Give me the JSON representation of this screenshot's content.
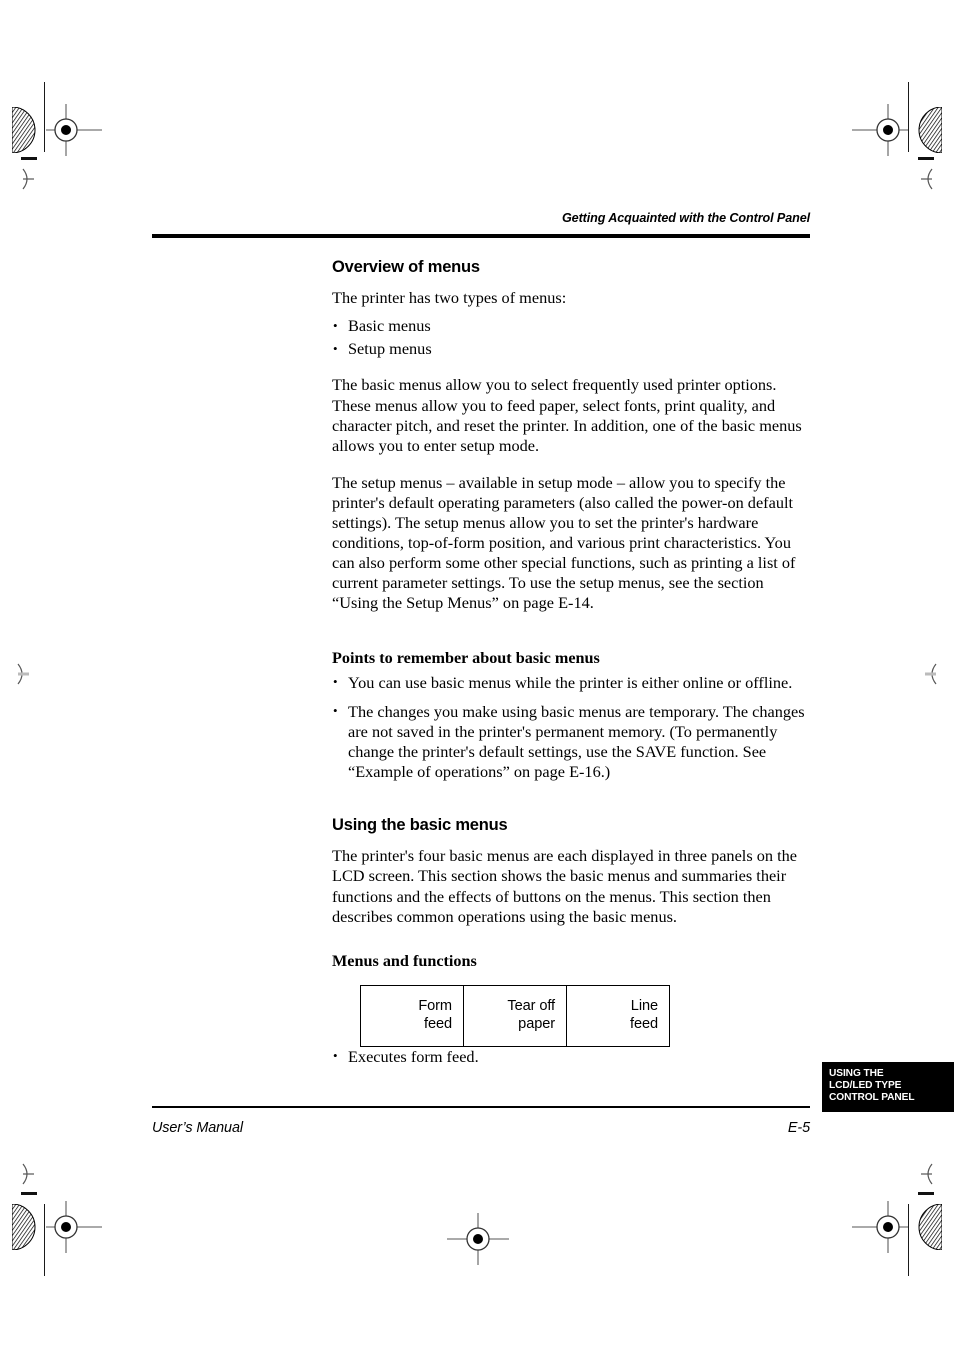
{
  "header": {
    "running_head": "Getting Acquainted with the Control Panel"
  },
  "content": {
    "section_title": "Overview of menus",
    "intro_paragraph": "The printer has two types of menus:",
    "menu_types": [
      "Basic menus",
      "Setup menus"
    ],
    "basic_menus_paragraph": "The basic menus allow you to select frequently used printer options. These menus allow you to feed paper, select fonts, print quality, and character pitch, and reset the printer. In addition, one of the basic menus allows you to enter setup mode.",
    "setup_menus_paragraph": "The setup menus – available in setup mode – allow you to specify the printer's default operating parameters (also called the power-on default settings). The setup menus allow you to set the printer's hardware conditions, top-of-form position, and various print characteristics. You can also perform some other special functions, such as printing a list of current parameter settings. To use the setup menus, see the section “Using the Setup Menus” on page E-14.",
    "points_heading": "Points to remember about basic menus",
    "points": [
      "You can use basic menus while the printer is either online or offline.",
      "The changes you make using basic menus are temporary. The changes are not saved in the printer's permanent memory. (To permanently change the printer's default settings, use the SAVE function. See “Example of operations” on page E-16.)"
    ],
    "using_heading": "Using the basic menus",
    "using_paragraph": "The printer's four basic menus are each displayed in three panels on the LCD screen. This section shows the basic menus and summaries their functions and the effects of buttons on the menus. This section then describes common operations using the basic menus.",
    "menus_functions_heading": "Menus and functions",
    "panel_table": {
      "cells": [
        {
          "line1": "Form",
          "line2": "feed"
        },
        {
          "line1": "Tear off",
          "line2": "paper"
        },
        {
          "line1": "Line",
          "line2": "feed"
        }
      ]
    },
    "panel_notes": [
      "Executes form feed."
    ]
  },
  "side_tab": {
    "lines": [
      "USING THE",
      "LCD/LED TYPE",
      "CONTROL PANEL"
    ],
    "background_color": "#000000",
    "text_color": "#ffffff"
  },
  "footer": {
    "manual_label": "User’s Manual",
    "page_number": "E-5"
  }
}
